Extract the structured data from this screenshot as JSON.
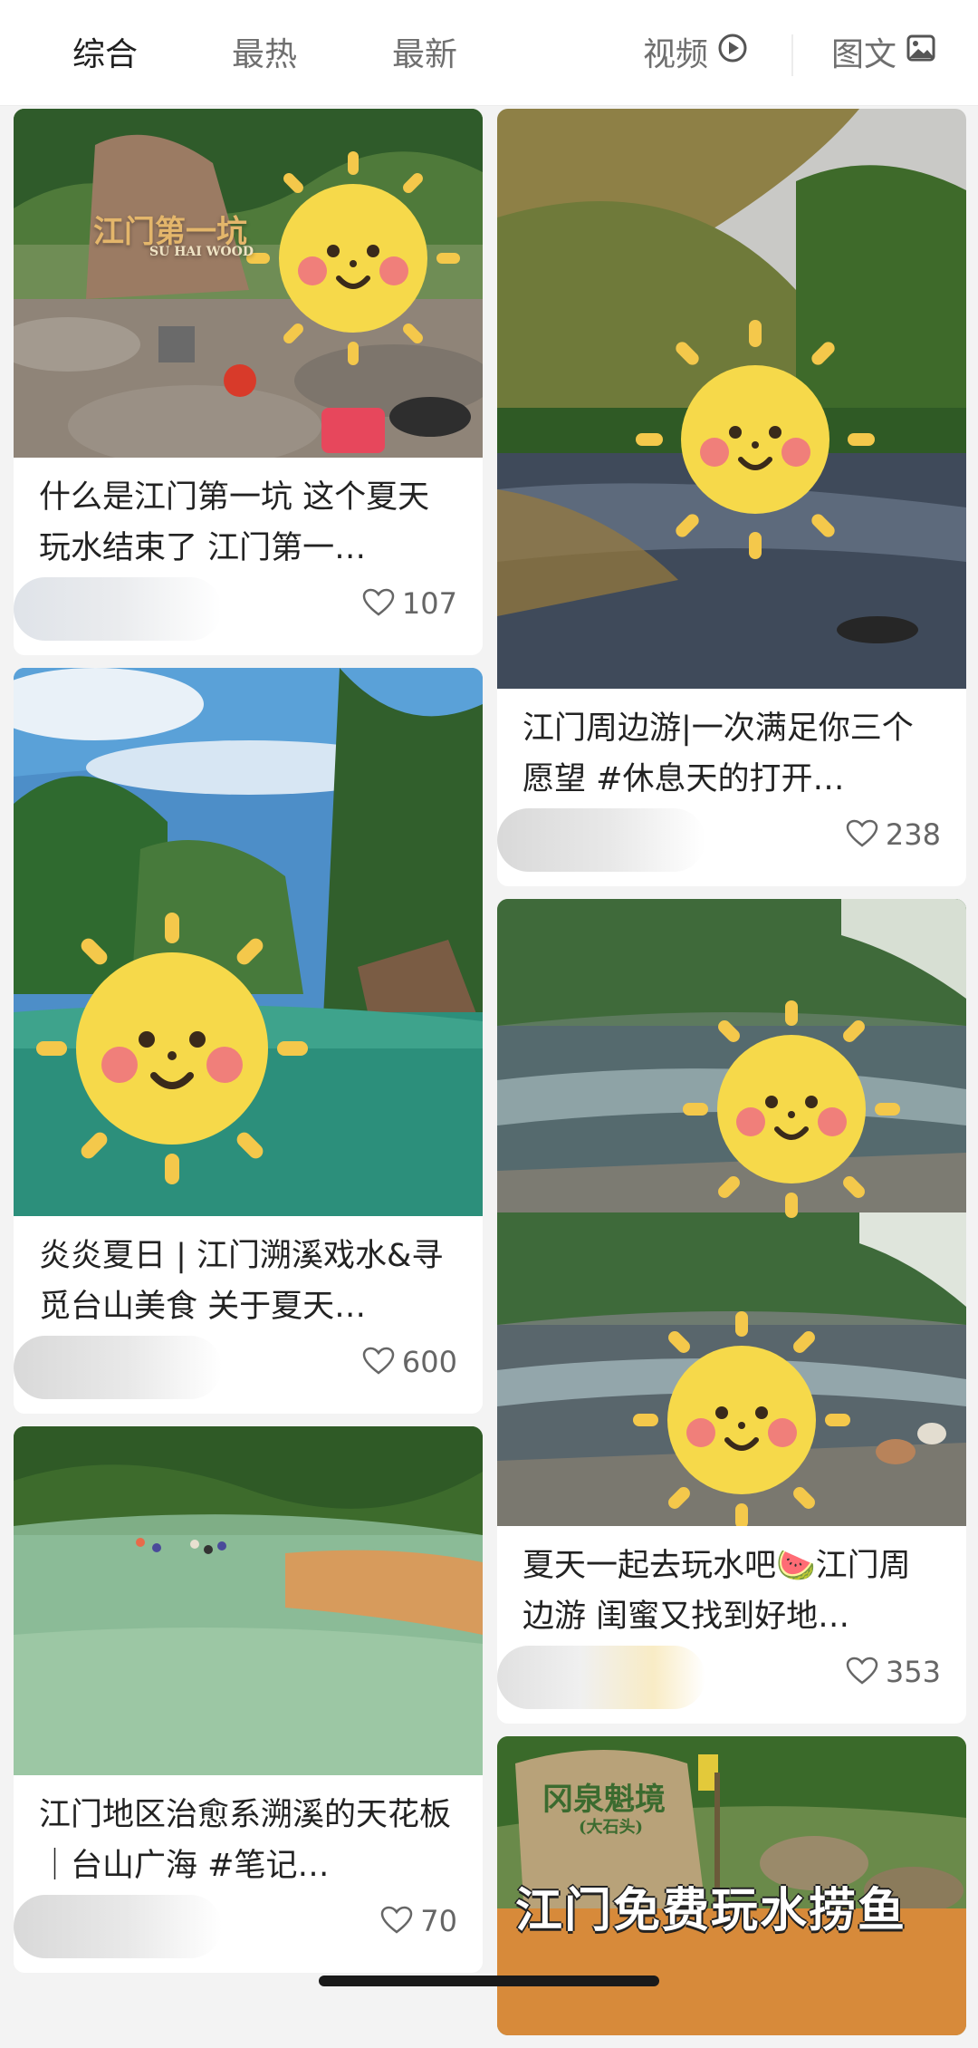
{
  "tabs": {
    "comprehensive": "综合",
    "hottest": "最热",
    "newest": "最新",
    "video": "视频",
    "image_text": "图文"
  },
  "feed": {
    "left": [
      {
        "image_text": "江门第一坑",
        "image_subtext": "SU HAI WOOD",
        "title": "什么是江门第一坑 这个夏天玩水结束了 江门第一…",
        "likes": "107"
      },
      {
        "title": "炎炎夏日 | 江门溯溪戏水&寻觅台山美食 关于夏天…",
        "likes": "600"
      },
      {
        "title": "江门地区治愈系溯溪的天花板｜台山广海 #笔记…",
        "likes": "70"
      }
    ],
    "right": [
      {
        "title": "江门周边游|一次满足你三个愿望 #休息天的打开…",
        "likes": "238"
      },
      {
        "title": "夏天一起去玩水吧🍉江门周边游 闺蜜又找到好地…",
        "likes": "353"
      },
      {
        "stone_text": "冈泉魁境",
        "stone_subtext": "(大石头)",
        "image_text": "江门免费玩水捞鱼"
      }
    ]
  },
  "colors": {
    "accent_text": "#1f1f1f",
    "muted_text": "#6f6f6f",
    "like_icon": "#666666"
  }
}
